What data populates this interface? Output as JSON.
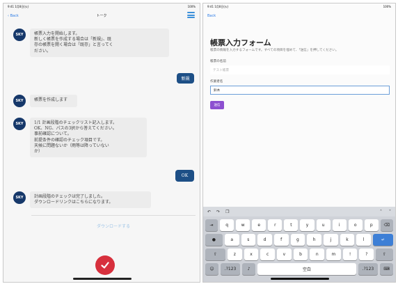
{
  "left": {
    "status": {
      "time": "9:41 1月8日(火)",
      "battery": "100%"
    },
    "nav": {
      "back": "Back",
      "title": "トーク"
    },
    "messages": [
      {
        "avatar": "SKY",
        "text": "帳票入力を開始します。\n新しく帳票を作成する場合は「新規」、既\n存の帳票を開く場合は「既存」と言ってく\nださい。"
      },
      {
        "avatar": "SKY",
        "text": "帳票を作成します"
      },
      {
        "avatar": "SKY",
        "text": "1/1 計画段階のチェックリスト記入します。\nOK、NG、パスの3択から答えてください。\n事前確認について。\n前提条件の確認のチェック項目です。\n天候に問題ないか（雨等は降っていない\nか）"
      },
      {
        "avatar": "SKY",
        "text": "計画段階のチェックは完了しました。\nダウンロードリンクはこちらになります。"
      }
    ],
    "replies": [
      "新規",
      "OK"
    ],
    "download": "ダウンロードする"
  },
  "right": {
    "status": {
      "time": "9:41 1月8日(火)",
      "battery": "100%"
    },
    "nav": {
      "back": "Back"
    },
    "form": {
      "title": "帳票入力フォーム",
      "description": "帳票の情報を入力するフォームです。すべての項目を埋めて、「送信」を押してください。",
      "field1_label": "帳票の名前",
      "field1_placeholder": "テスト帳票",
      "field2_label": "作業者名",
      "field2_value": "鈴木",
      "submit": "送信"
    },
    "keyboard": {
      "row1": [
        "q",
        "w",
        "e",
        "r",
        "t",
        "y",
        "u",
        "i",
        "o",
        "p"
      ],
      "row2": [
        "a",
        "s",
        "d",
        "f",
        "g",
        "h",
        "j",
        "k",
        "l"
      ],
      "row3": [
        "z",
        "x",
        "c",
        "v",
        "b",
        "n",
        "m",
        "!",
        "?"
      ],
      "space": "空白",
      "mode": ".?123"
    }
  }
}
